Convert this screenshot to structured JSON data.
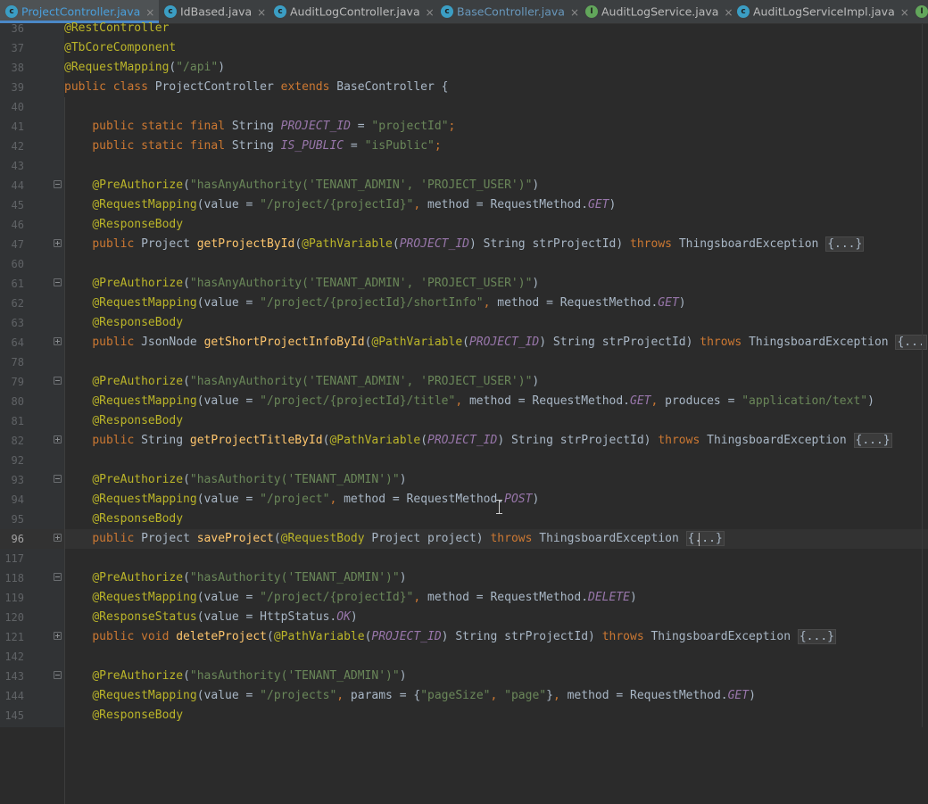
{
  "tabs": [
    {
      "label": "ProjectController.java",
      "type": "class",
      "icon": "class-icon",
      "glyph": "c",
      "active": true
    },
    {
      "label": "IdBased.java",
      "type": "class",
      "icon": "class-icon",
      "glyph": "c",
      "active": false
    },
    {
      "label": "AuditLogController.java",
      "type": "class",
      "icon": "class-icon",
      "glyph": "c",
      "active": false
    },
    {
      "label": "BaseController.java",
      "type": "class",
      "icon": "class-icon",
      "glyph": "c",
      "active": false,
      "modified": true
    },
    {
      "label": "AuditLogService.java",
      "type": "interface",
      "icon": "interface-icon",
      "glyph": "I",
      "active": false
    },
    {
      "label": "AuditLogServiceImpl.java",
      "type": "class",
      "icon": "class-icon",
      "glyph": "c",
      "active": false
    }
  ],
  "tab_close_glyph": "×",
  "colors": {
    "background": "#2b2b2b",
    "gutter": "#313335",
    "keyword": "#cc7832",
    "annotation": "#bbb529",
    "string": "#6a8759",
    "constant": "#9876aa",
    "method": "#ffc66d",
    "text": "#a9b7c6",
    "active_tab_text": "#4a9fdb"
  },
  "lines": [
    {
      "n": "36",
      "tokens": [
        [
          "ann",
          "@RestController"
        ]
      ]
    },
    {
      "n": "37",
      "tokens": [
        [
          "ann",
          "@TbCoreComponent"
        ]
      ]
    },
    {
      "n": "38",
      "tokens": [
        [
          "ann",
          "@RequestMapping"
        ],
        [
          "",
          "("
        ],
        [
          "str",
          "\"/api\""
        ],
        [
          "",
          ")"
        ]
      ]
    },
    {
      "n": "39",
      "tokens": [
        [
          "kw",
          "public class "
        ],
        [
          "",
          "ProjectController "
        ],
        [
          "kw",
          "extends "
        ],
        [
          "",
          "BaseController {"
        ]
      ]
    },
    {
      "n": "40",
      "tokens": []
    },
    {
      "n": "41",
      "tokens": [
        [
          "",
          "    "
        ],
        [
          "kw",
          "public static final "
        ],
        [
          "",
          "String "
        ],
        [
          "const",
          "PROJECT_ID"
        ],
        [
          "",
          " = "
        ],
        [
          "str",
          "\"projectId\""
        ],
        [
          "kw",
          ";"
        ]
      ]
    },
    {
      "n": "42",
      "tokens": [
        [
          "",
          "    "
        ],
        [
          "kw",
          "public static final "
        ],
        [
          "",
          "String "
        ],
        [
          "const",
          "IS_PUBLIC"
        ],
        [
          "",
          " = "
        ],
        [
          "str",
          "\"isPublic\""
        ],
        [
          "kw",
          ";"
        ]
      ]
    },
    {
      "n": "43",
      "tokens": []
    },
    {
      "n": "44",
      "fold": "minus",
      "tokens": [
        [
          "",
          "    "
        ],
        [
          "ann",
          "@PreAuthorize"
        ],
        [
          "",
          "("
        ],
        [
          "str",
          "\"hasAnyAuthority('TENANT_ADMIN', 'PROJECT_USER')\""
        ],
        [
          "",
          ")"
        ]
      ]
    },
    {
      "n": "45",
      "tokens": [
        [
          "",
          "    "
        ],
        [
          "ann",
          "@RequestMapping"
        ],
        [
          "",
          "(value = "
        ],
        [
          "str",
          "\"/project/{projectId}\""
        ],
        [
          "kw",
          ", "
        ],
        [
          "",
          "method = RequestMethod."
        ],
        [
          "const",
          "GET"
        ],
        [
          "",
          ")"
        ]
      ]
    },
    {
      "n": "46",
      "tokens": [
        [
          "",
          "    "
        ],
        [
          "ann",
          "@ResponseBody"
        ]
      ]
    },
    {
      "n": "47",
      "fold": "plus",
      "tokens": [
        [
          "",
          "    "
        ],
        [
          "kw",
          "public "
        ],
        [
          "",
          "Project "
        ],
        [
          "fn",
          "getProjectById"
        ],
        [
          "",
          "("
        ],
        [
          "ann",
          "@PathVariable"
        ],
        [
          "",
          "("
        ],
        [
          "const",
          "PROJECT_ID"
        ],
        [
          "",
          ") String strProjectId) "
        ],
        [
          "kw",
          "throws "
        ],
        [
          "",
          "ThingsboardException "
        ],
        [
          "folded",
          "{...}"
        ]
      ]
    },
    {
      "n": "60",
      "tokens": []
    },
    {
      "n": "61",
      "fold": "minus",
      "tokens": [
        [
          "",
          "    "
        ],
        [
          "ann",
          "@PreAuthorize"
        ],
        [
          "",
          "("
        ],
        [
          "str",
          "\"hasAnyAuthority('TENANT_ADMIN', 'PROJECT_USER')\""
        ],
        [
          "",
          ")"
        ]
      ]
    },
    {
      "n": "62",
      "tokens": [
        [
          "",
          "    "
        ],
        [
          "ann",
          "@RequestMapping"
        ],
        [
          "",
          "(value = "
        ],
        [
          "str",
          "\"/project/{projectId}/shortInfo\""
        ],
        [
          "kw",
          ", "
        ],
        [
          "",
          "method = RequestMethod."
        ],
        [
          "const",
          "GET"
        ],
        [
          "",
          ")"
        ]
      ]
    },
    {
      "n": "63",
      "tokens": [
        [
          "",
          "    "
        ],
        [
          "ann",
          "@ResponseBody"
        ]
      ]
    },
    {
      "n": "64",
      "fold": "plus",
      "tokens": [
        [
          "",
          "    "
        ],
        [
          "kw",
          "public "
        ],
        [
          "",
          "JsonNode "
        ],
        [
          "fn",
          "getShortProjectInfoById"
        ],
        [
          "",
          "("
        ],
        [
          "ann",
          "@PathVariable"
        ],
        [
          "",
          "("
        ],
        [
          "const",
          "PROJECT_ID"
        ],
        [
          "",
          ") String strProjectId) "
        ],
        [
          "kw",
          "throws "
        ],
        [
          "",
          "ThingsboardException "
        ],
        [
          "folded",
          "{..."
        ]
      ]
    },
    {
      "n": "78",
      "tokens": []
    },
    {
      "n": "79",
      "fold": "minus",
      "tokens": [
        [
          "",
          "    "
        ],
        [
          "ann",
          "@PreAuthorize"
        ],
        [
          "",
          "("
        ],
        [
          "str",
          "\"hasAnyAuthority('TENANT_ADMIN', 'PROJECT_USER')\""
        ],
        [
          "",
          ")"
        ]
      ]
    },
    {
      "n": "80",
      "tokens": [
        [
          "",
          "    "
        ],
        [
          "ann",
          "@RequestMapping"
        ],
        [
          "",
          "(value = "
        ],
        [
          "str",
          "\"/project/{projectId}/title\""
        ],
        [
          "kw",
          ", "
        ],
        [
          "",
          "method = RequestMethod."
        ],
        [
          "const",
          "GET"
        ],
        [
          "kw",
          ", "
        ],
        [
          "",
          "produces = "
        ],
        [
          "str",
          "\"application/text\""
        ],
        [
          "",
          ")"
        ]
      ]
    },
    {
      "n": "81",
      "tokens": [
        [
          "",
          "    "
        ],
        [
          "ann",
          "@ResponseBody"
        ]
      ]
    },
    {
      "n": "82",
      "fold": "plus",
      "tokens": [
        [
          "",
          "    "
        ],
        [
          "kw",
          "public "
        ],
        [
          "",
          "String "
        ],
        [
          "fn",
          "getProjectTitleById"
        ],
        [
          "",
          "("
        ],
        [
          "ann",
          "@PathVariable"
        ],
        [
          "",
          "("
        ],
        [
          "const",
          "PROJECT_ID"
        ],
        [
          "",
          ") String strProjectId) "
        ],
        [
          "kw",
          "throws "
        ],
        [
          "",
          "ThingsboardException "
        ],
        [
          "folded",
          "{...}"
        ]
      ]
    },
    {
      "n": "92",
      "tokens": []
    },
    {
      "n": "93",
      "fold": "minus",
      "tokens": [
        [
          "",
          "    "
        ],
        [
          "ann",
          "@PreAuthorize"
        ],
        [
          "",
          "("
        ],
        [
          "str",
          "\"hasAuthority('TENANT_ADMIN')\""
        ],
        [
          "",
          ")"
        ]
      ]
    },
    {
      "n": "94",
      "tokens": [
        [
          "",
          "    "
        ],
        [
          "ann",
          "@RequestMapping"
        ],
        [
          "",
          "(value = "
        ],
        [
          "str",
          "\"/project\""
        ],
        [
          "kw",
          ", "
        ],
        [
          "",
          "method = RequestMethod."
        ],
        [
          "const",
          "POST"
        ],
        [
          "",
          ")"
        ]
      ]
    },
    {
      "n": "95",
      "tokens": [
        [
          "",
          "    "
        ],
        [
          "ann",
          "@ResponseBody"
        ]
      ]
    },
    {
      "n": "96",
      "fold": "plus",
      "current": true,
      "tokens": [
        [
          "",
          "    "
        ],
        [
          "kw",
          "public "
        ],
        [
          "",
          "Project "
        ],
        [
          "fn",
          "saveProject"
        ],
        [
          "",
          "("
        ],
        [
          "ann",
          "@RequestBody "
        ],
        [
          "",
          "Project project) "
        ],
        [
          "kw",
          "throws "
        ],
        [
          "",
          "ThingsboardException "
        ],
        [
          "folded",
          "{...}"
        ]
      ]
    },
    {
      "n": "117",
      "tokens": []
    },
    {
      "n": "118",
      "fold": "minus",
      "tokens": [
        [
          "",
          "    "
        ],
        [
          "ann",
          "@PreAuthorize"
        ],
        [
          "",
          "("
        ],
        [
          "str",
          "\"hasAuthority('TENANT_ADMIN')\""
        ],
        [
          "",
          ")"
        ]
      ]
    },
    {
      "n": "119",
      "tokens": [
        [
          "",
          "    "
        ],
        [
          "ann",
          "@RequestMapping"
        ],
        [
          "",
          "(value = "
        ],
        [
          "str",
          "\"/project/{projectId}\""
        ],
        [
          "kw",
          ", "
        ],
        [
          "",
          "method = RequestMethod."
        ],
        [
          "const",
          "DELETE"
        ],
        [
          "",
          ")"
        ]
      ]
    },
    {
      "n": "120",
      "tokens": [
        [
          "",
          "    "
        ],
        [
          "ann",
          "@ResponseStatus"
        ],
        [
          "",
          "(value = HttpStatus."
        ],
        [
          "const",
          "OK"
        ],
        [
          "",
          ")"
        ]
      ]
    },
    {
      "n": "121",
      "fold": "plus",
      "tokens": [
        [
          "",
          "    "
        ],
        [
          "kw",
          "public void "
        ],
        [
          "fn",
          "deleteProject"
        ],
        [
          "",
          "("
        ],
        [
          "ann",
          "@PathVariable"
        ],
        [
          "",
          "("
        ],
        [
          "const",
          "PROJECT_ID"
        ],
        [
          "",
          ") String strProjectId) "
        ],
        [
          "kw",
          "throws "
        ],
        [
          "",
          "ThingsboardException "
        ],
        [
          "folded",
          "{...}"
        ]
      ]
    },
    {
      "n": "142",
      "tokens": []
    },
    {
      "n": "143",
      "fold": "minus",
      "tokens": [
        [
          "",
          "    "
        ],
        [
          "ann",
          "@PreAuthorize"
        ],
        [
          "",
          "("
        ],
        [
          "str",
          "\"hasAuthority('TENANT_ADMIN')\""
        ],
        [
          "",
          ")"
        ]
      ]
    },
    {
      "n": "144",
      "tokens": [
        [
          "",
          "    "
        ],
        [
          "ann",
          "@RequestMapping"
        ],
        [
          "",
          "(value = "
        ],
        [
          "str",
          "\"/projects\""
        ],
        [
          "kw",
          ", "
        ],
        [
          "",
          "params = {"
        ],
        [
          "str",
          "\"pageSize\""
        ],
        [
          "kw",
          ", "
        ],
        [
          "str",
          "\"page\""
        ],
        [
          "",
          "}"
        ],
        [
          "kw",
          ", "
        ],
        [
          "",
          "method = RequestMethod."
        ],
        [
          "const",
          "GET"
        ],
        [
          "",
          ")"
        ]
      ]
    },
    {
      "n": "145",
      "tokens": [
        [
          "",
          "    "
        ],
        [
          "ann",
          "@ResponseBody"
        ]
      ]
    }
  ]
}
